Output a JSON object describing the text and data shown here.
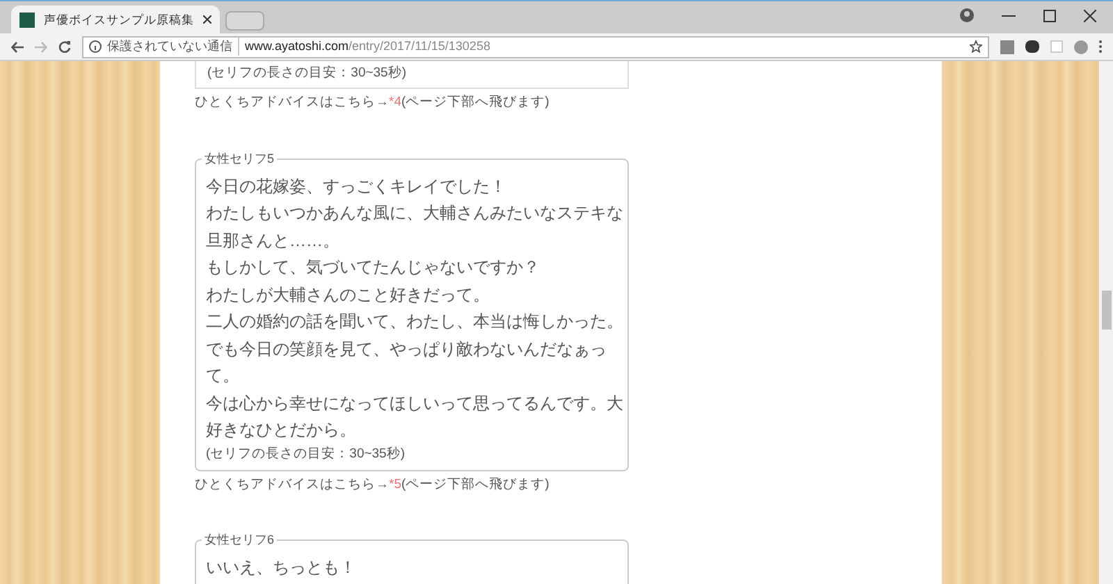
{
  "browser": {
    "tab_title": "声優ボイスサンプル原稿集",
    "security": "保護されていない通信",
    "url_host": "www.ayatoshi.com",
    "url_path": "/entry/2017/11/15/130258"
  },
  "top": {
    "note": "(セリフの長さの目安：30~35秒)",
    "advice": {
      "text": "ひとくちアドバイスはこちら→",
      "link": "*4",
      "after": "(ページ下部へ飛びます)"
    }
  },
  "lines": [
    {
      "legend": "女性セリフ5",
      "lines": [
        "今日の花嫁姿、すっごくキレイでした！",
        "わたしもいつかあんな風に、大輔さんみたいなステキな",
        "旦那さんと……。",
        "もしかして、気づいてたんじゃないですか？",
        "わたしが大輔さんのこと好きだって。",
        "二人の婚約の話を聞いて、わたし、本当は悔しかった。",
        "でも今日の笑顔を見て、やっぱり敵わないんだなぁっ",
        "て。",
        "今は心から幸せになってほしいって思ってるんです。大",
        "好きなひとだから。"
      ],
      "note": "(セリフの長さの目安：30~35秒)",
      "advice": {
        "text": "ひとくちアドバイスはこちら→",
        "link": "*5",
        "after": "(ページ下部へ飛びます)"
      }
    },
    {
      "legend": "女性セリフ6",
      "lines": [
        "いいえ、ちっとも！"
      ]
    }
  ]
}
